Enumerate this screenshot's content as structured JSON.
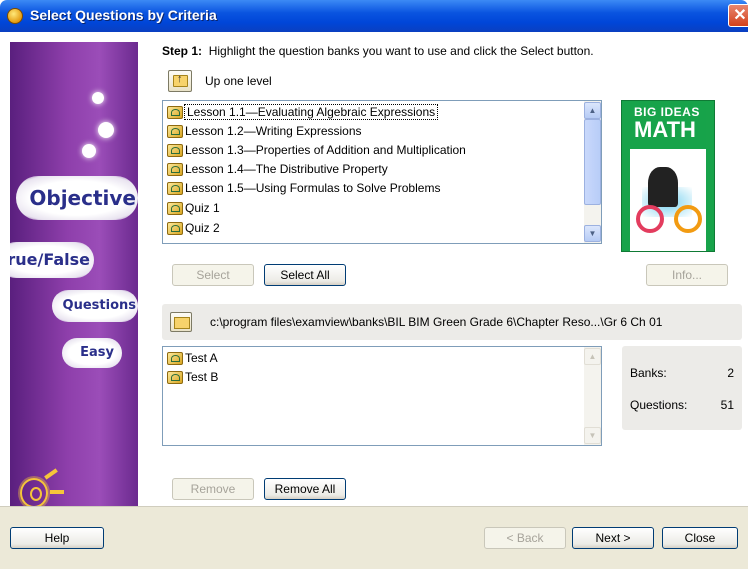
{
  "window": {
    "title": "Select Questions by Criteria",
    "close": "✕"
  },
  "sidebar": {
    "labels": [
      "Objective",
      "True/False",
      "Questions",
      "Easy"
    ]
  },
  "step1": {
    "prefix": "Step 1:",
    "text": "Highlight the question banks you want to use and click the Select button."
  },
  "up_level": {
    "label": "Up one level",
    "icon": "folder-up-icon"
  },
  "banks": {
    "items": [
      "Lesson 1.1—Evaluating Algebraic Expressions",
      "Lesson 1.2—Writing Expressions",
      "Lesson 1.3—Properties of Addition and Multiplication",
      "Lesson 1.4—The Distributive Property",
      "Lesson 1.5—Using Formulas to Solve Problems",
      "Quiz 1",
      "Quiz 2"
    ],
    "selected_index": 0
  },
  "cover": {
    "line1": "BIG IDEAS",
    "line2": "MATH"
  },
  "buttons": {
    "select": "Select",
    "select_all": "Select All",
    "info": "Info...",
    "remove": "Remove",
    "remove_all": "Remove All",
    "help": "Help",
    "back": "< Back",
    "next": "Next >",
    "close": "Close"
  },
  "path": "c:\\program files\\examview\\banks\\BIL BIM Green Grade 6\\Chapter Reso...\\Gr 6 Ch 01",
  "selected_banks": [
    "Test A",
    "Test B"
  ],
  "stats": {
    "banks_label": "Banks:",
    "banks_value": "2",
    "questions_label": "Questions:",
    "questions_value": "51"
  }
}
